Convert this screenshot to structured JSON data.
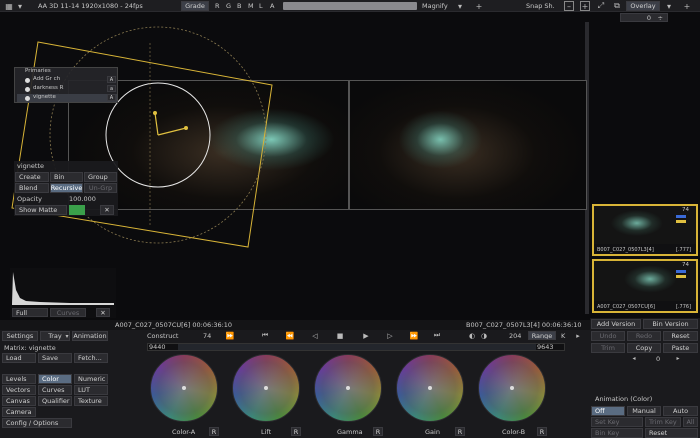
{
  "topbar": {
    "title": "AA 3D 11-14 1920x1080 - 24fps",
    "grade_label": "Grade",
    "channels": [
      "R",
      "G",
      "B",
      "M",
      "L",
      "A"
    ],
    "magnify_label": "Magnify",
    "snap_label": "Snap Sh.",
    "overlay_label": "Overlay",
    "overlay_value": "0"
  },
  "layers": {
    "title": "Primaries",
    "items": [
      {
        "label": "Add Gr ch",
        "tag": "A"
      },
      {
        "label": "darkness R",
        "tag": "a"
      },
      {
        "label": "vignette",
        "tag": "A"
      }
    ]
  },
  "vignette_panel": {
    "title": "vignette",
    "create": "Create",
    "bin": "Bin",
    "group": "Group",
    "blend": "Blend",
    "recursive": "Recursive",
    "ungrp": "Un-Grp",
    "opacity_label": "Opacity",
    "opacity_value": "100.000",
    "show_matte": "Show Matte",
    "x": "✕"
  },
  "histogram": {
    "full_label": "Full",
    "curves_label": "Curves",
    "x": "✕"
  },
  "thumbs": [
    {
      "badge": "74",
      "name": "B007_C027_0507L3[4]",
      "num": "[.777]"
    },
    {
      "badge": "74",
      "name": "A007_C027_0507CU[6]",
      "num": "[.776]"
    }
  ],
  "timeline": {
    "left_clip": "A007_C027_0507CU[6] 00:06:36:10",
    "right_clip": "B007_C027_0507L3[4] 00:06:36:10",
    "construct": "Construct",
    "frame_start": "74",
    "frame_end": "204",
    "range": "Range",
    "k": "K",
    "slider_left": "9440",
    "slider_right": "9643"
  },
  "left_panel": {
    "settings": "Settings",
    "tray": "Tray",
    "animation": "Animation",
    "matrix_label": "Matrix: vignette",
    "load": "Load",
    "save": "Save",
    "fetch": "Fetch...",
    "tools": [
      [
        "Levels",
        "Color",
        "Numeric"
      ],
      [
        "Vectors",
        "Curves",
        "LUT"
      ],
      [
        "Canvas",
        "Qualifier",
        "Texture"
      ],
      [
        "Camera",
        "",
        ""
      ]
    ],
    "config": "Config / Options"
  },
  "wheels": [
    {
      "label": "Color-A",
      "r": "R"
    },
    {
      "label": "Lift",
      "r": "R"
    },
    {
      "label": "Gamma",
      "r": "R"
    },
    {
      "label": "Gain",
      "r": "R"
    },
    {
      "label": "Color-B",
      "r": "R"
    }
  ],
  "right_panel": {
    "add_version": "Add Version",
    "bin_version": "Bin Version",
    "undo": "Undo",
    "redo": "Redo",
    "reset": "Reset",
    "trim": "Trim",
    "copy": "Copy",
    "paste": "Paste",
    "counter": "0",
    "anim_title": "Animation (Color)",
    "off": "Off",
    "manual": "Manual",
    "auto": "Auto",
    "set_key": "Set Key",
    "trim_key": "Trim Key",
    "all": "All",
    "bin_key": "Bin Key",
    "reset2": "Reset"
  }
}
